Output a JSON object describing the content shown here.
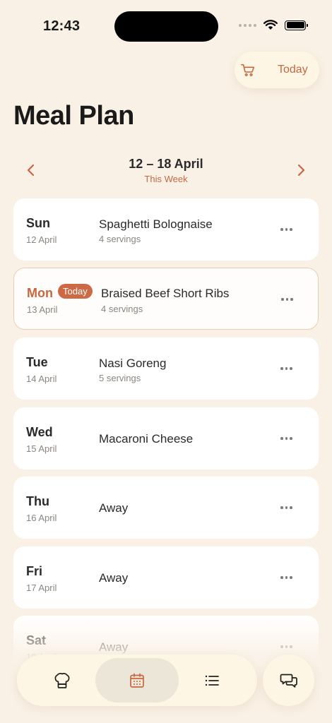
{
  "status_bar": {
    "time": "12:43"
  },
  "header": {
    "today_button_label": "Today",
    "title": "Meal Plan"
  },
  "week": {
    "range": "12 – 18 April",
    "subtitle": "This Week"
  },
  "days": [
    {
      "day": "Sun",
      "date": "12 April",
      "meal": "Spaghetti Bolognaise",
      "servings": "4 servings"
    },
    {
      "day": "Mon",
      "date": "13 April",
      "badge": "Today",
      "meal": "Braised Beef Short Ribs",
      "servings": "4 servings"
    },
    {
      "day": "Tue",
      "date": "14 April",
      "meal": "Nasi Goreng",
      "servings": "5 servings"
    },
    {
      "day": "Wed",
      "date": "15 April",
      "meal": "Macaroni Cheese"
    },
    {
      "day": "Thu",
      "date": "16 April",
      "meal": "Away"
    },
    {
      "day": "Fri",
      "date": "17 April",
      "meal": "Away"
    },
    {
      "day": "Sat",
      "date": "18 April",
      "meal": "Away"
    }
  ],
  "tabbar": {
    "tabs": [
      {
        "icon": "chef-hat-icon"
      },
      {
        "icon": "calendar-icon",
        "active": true
      },
      {
        "icon": "list-icon"
      }
    ],
    "chat_icon": "chat-bubbles-icon"
  },
  "colors": {
    "accent": "#c7673f",
    "background": "#faf1e6",
    "card": "#ffffff"
  }
}
